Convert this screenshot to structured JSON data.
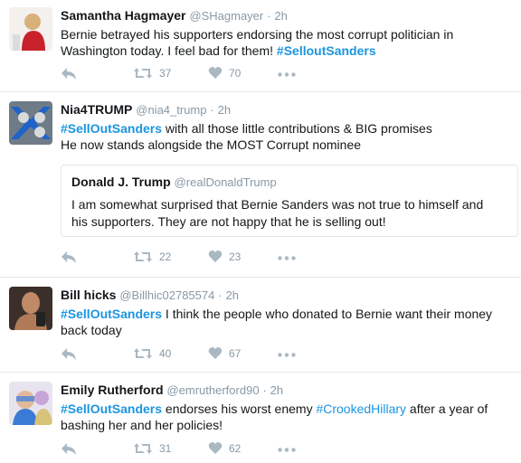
{
  "tweets": [
    {
      "name": "Samantha Hagmayer",
      "handle": "@SHagmayer",
      "sep": "·",
      "time": "2h",
      "text_1": "Bernie betrayed his supporters endorsing the most corrupt politician in",
      "text_2a": "Washington today. I feel bad for them! ",
      "hashtag": "#SelloutSanders",
      "retweets": "37",
      "likes": "70"
    },
    {
      "name": "Nia4TRUMP",
      "handle": "@nia4_trump",
      "sep": "·",
      "time": "2h",
      "hashtag": "#SellOutSanders",
      "text_1": " with all those little contributions & BIG promises",
      "text_2": "He now stands alongside the MOST Corrupt nominee",
      "quote": {
        "name": "Donald J. Trump",
        "handle": "@realDonaldTrump",
        "text_1": "I am somewhat surprised that Bernie Sanders was not true to himself and",
        "text_2": "his supporters. They are not happy that he is selling out!"
      },
      "retweets": "22",
      "likes": "23"
    },
    {
      "name": "Bill hicks",
      "handle": "@Billhic02785574",
      "sep": "·",
      "time": "2h",
      "hashtag": "#SellOutSanders",
      "text_1": " I think the people who donated to Bernie want their money",
      "text_2": "back today",
      "retweets": "40",
      "likes": "67"
    },
    {
      "name": "Emily Rutherford",
      "handle": "@emrutherford90",
      "sep": "·",
      "time": "2h",
      "hashtag": "#SellOutSanders",
      "text_1": " endorses his worst enemy ",
      "hashtag_2": "#CrookedHillary",
      "text_1b": " after a year of",
      "text_2": "bashing her and her policies!",
      "retweets": "31",
      "likes": "62"
    }
  ],
  "icons": {
    "reply": "reply-icon",
    "retweet": "retweet-icon",
    "like": "heart-icon",
    "more": "more-icon"
  },
  "colors": {
    "hashtag": "#1b95e0",
    "muted": "#8899a6",
    "icon": "#aab8c2",
    "divider": "#e1e8ed"
  }
}
